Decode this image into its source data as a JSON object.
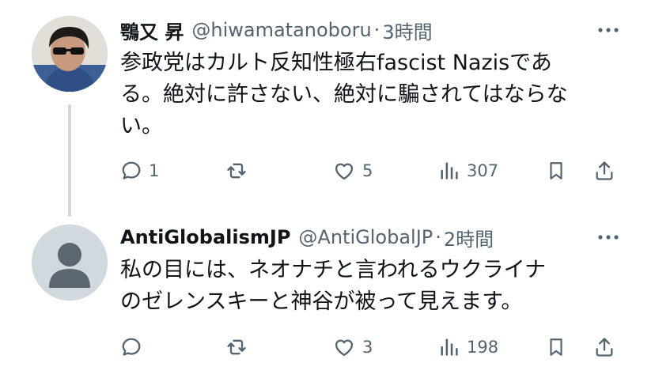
{
  "tweets": [
    {
      "author_name": "鶚又 昇",
      "handle": "@hiwamatanoboru",
      "separator": "·",
      "time": "3時間",
      "text_lines": [
        "参政党はカルト反知性極右fascist Nazisであ",
        "る。絶対に許さない、絶対に騙されてはならな",
        "い。"
      ],
      "replies": "1",
      "retweets": "",
      "likes": "5",
      "views": "307"
    },
    {
      "author_name": "AntiGlobalismJP",
      "handle": "@AntiGlobalJP",
      "separator": "·",
      "time": "2時間",
      "text_lines": [
        "私の目には、ネオナチと言われるウクライナ",
        "のゼレンスキーと神谷が被って見えます。"
      ],
      "replies": "",
      "retweets": "",
      "likes": "3",
      "views": "198"
    }
  ],
  "colors": {
    "text": "#0f1419",
    "muted": "#536471",
    "thread_line": "#cfd9de"
  },
  "icons": [
    "reply-icon",
    "retweet-icon",
    "like-icon",
    "views-icon",
    "bookmark-icon",
    "share-icon",
    "more-icon"
  ]
}
